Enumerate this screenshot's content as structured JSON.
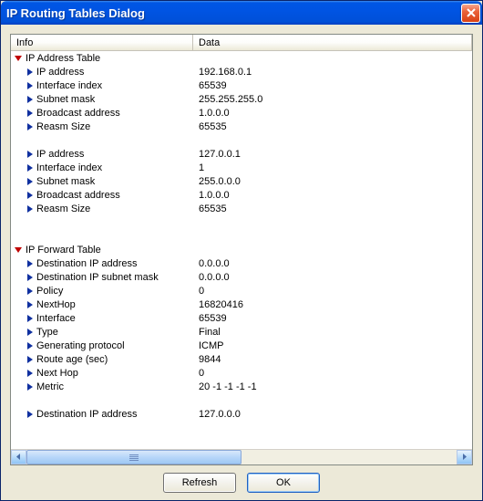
{
  "title": "IP Routing Tables Dialog",
  "columns": {
    "info": "Info",
    "data": "Data"
  },
  "buttons": {
    "refresh": "Refresh",
    "ok": "OK"
  },
  "rows": [
    {
      "type": "group",
      "indent": 1,
      "label": "IP Address Table",
      "value": ""
    },
    {
      "type": "leaf",
      "indent": 2,
      "label": "IP address",
      "value": "192.168.0.1"
    },
    {
      "type": "leaf",
      "indent": 2,
      "label": "Interface index",
      "value": "65539"
    },
    {
      "type": "leaf",
      "indent": 2,
      "label": "Subnet mask",
      "value": "255.255.255.0"
    },
    {
      "type": "leaf",
      "indent": 2,
      "label": "Broadcast address",
      "value": "1.0.0.0"
    },
    {
      "type": "leaf",
      "indent": 2,
      "label": "Reasm Size",
      "value": "65535"
    },
    {
      "type": "blank"
    },
    {
      "type": "leaf",
      "indent": 2,
      "label": "IP address",
      "value": "127.0.0.1"
    },
    {
      "type": "leaf",
      "indent": 2,
      "label": "Interface index",
      "value": "1"
    },
    {
      "type": "leaf",
      "indent": 2,
      "label": "Subnet mask",
      "value": "255.0.0.0"
    },
    {
      "type": "leaf",
      "indent": 2,
      "label": "Broadcast address",
      "value": "1.0.0.0"
    },
    {
      "type": "leaf",
      "indent": 2,
      "label": "Reasm Size",
      "value": "65535"
    },
    {
      "type": "blank"
    },
    {
      "type": "blank"
    },
    {
      "type": "group",
      "indent": 1,
      "label": "IP Forward Table",
      "value": ""
    },
    {
      "type": "leaf",
      "indent": 2,
      "label": "Destination IP address",
      "value": "0.0.0.0"
    },
    {
      "type": "leaf",
      "indent": 2,
      "label": "Destination IP subnet mask",
      "value": "0.0.0.0"
    },
    {
      "type": "leaf",
      "indent": 2,
      "label": "Policy",
      "value": "0"
    },
    {
      "type": "leaf",
      "indent": 2,
      "label": "NextHop",
      "value": "16820416"
    },
    {
      "type": "leaf",
      "indent": 2,
      "label": "Interface",
      "value": "65539"
    },
    {
      "type": "leaf",
      "indent": 2,
      "label": "Type",
      "value": "Final"
    },
    {
      "type": "leaf",
      "indent": 2,
      "label": "Generating protocol",
      "value": "ICMP"
    },
    {
      "type": "leaf",
      "indent": 2,
      "label": "Route age (sec)",
      "value": "9844"
    },
    {
      "type": "leaf",
      "indent": 2,
      "label": "Next Hop",
      "value": "0"
    },
    {
      "type": "leaf",
      "indent": 2,
      "label": "Metric",
      "value": "20 -1 -1 -1 -1"
    },
    {
      "type": "blank"
    },
    {
      "type": "leaf",
      "indent": 2,
      "label": "Destination IP address",
      "value": "127.0.0.0"
    }
  ]
}
